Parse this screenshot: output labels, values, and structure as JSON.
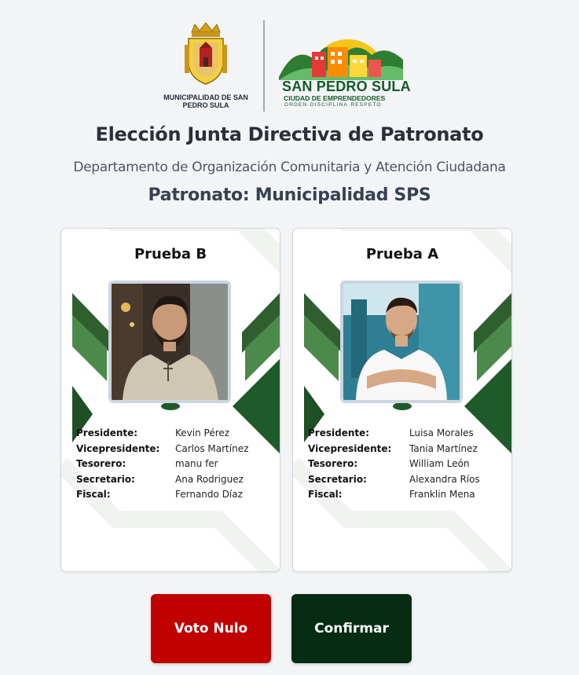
{
  "header": {
    "logo_muni_text": "MUNICIPALIDAD DE SAN PEDRO SULA",
    "logo_sps_title": "SAN PEDRO SULA",
    "logo_sps_subtitle": "CIUDAD DE EMPRENDEDORES",
    "logo_sps_motto": "ORDEN·DISCIPLINA·RESPETO"
  },
  "title": "Elección Junta Directiva de Patronato",
  "subtitle": "Departamento de Organización Comunitaria y Atención Ciudadana",
  "patronato_label": "Patronato: Municipalidad SPS",
  "cards": [
    {
      "name": "Prueba B",
      "roles": [
        {
          "label": "Presidente:",
          "value": "Kevin Pérez"
        },
        {
          "label": "Vicepresidente:",
          "value": "Carlos Martínez"
        },
        {
          "label": "Tesorero:",
          "value": "manu fer"
        },
        {
          "label": "Secretario:",
          "value": "Ana Rodriguez"
        },
        {
          "label": "Fiscal:",
          "value": "Fernando Díaz"
        }
      ]
    },
    {
      "name": "Prueba A",
      "roles": [
        {
          "label": "Presidente:",
          "value": "Luisa Morales"
        },
        {
          "label": "Vicepresidente:",
          "value": "Tania Martínez"
        },
        {
          "label": "Tesorero:",
          "value": "William León"
        },
        {
          "label": "Secretario:",
          "value": "Alexandra Ríos"
        },
        {
          "label": "Fiscal:",
          "value": "Franklin Mena"
        }
      ]
    }
  ],
  "buttons": {
    "null_vote": "Voto Nulo",
    "confirm": "Confirmar"
  },
  "colors": {
    "null_vote": "#c10000",
    "confirm": "#062d14",
    "card_accent": "#1f5a2b"
  }
}
